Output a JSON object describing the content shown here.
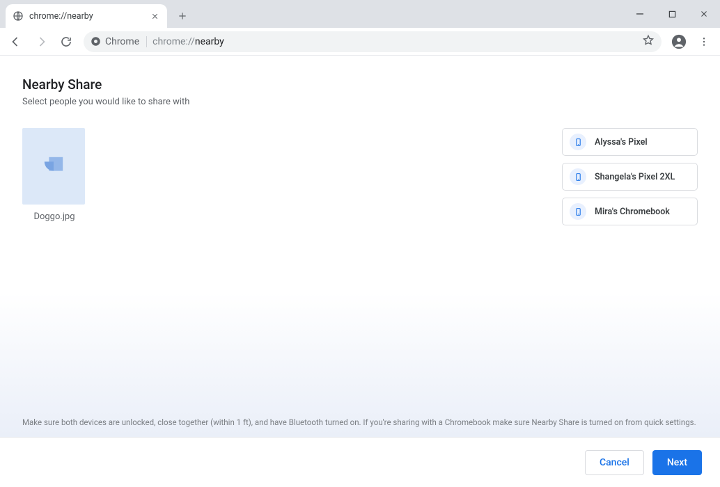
{
  "window": {
    "tab_title": "chrome://nearby"
  },
  "omnibox": {
    "chip_label": "Chrome",
    "url_prefix": "chrome://",
    "url_path": "nearby"
  },
  "page": {
    "title": "Nearby Share",
    "subtitle": "Select people you would like to share with",
    "file": {
      "name": "Doggo.jpg"
    },
    "devices": [
      {
        "name": "Alyssa's Pixel",
        "icon": "phone-icon"
      },
      {
        "name": "Shangela's Pixel 2XL",
        "icon": "phone-icon"
      },
      {
        "name": "Mira's Chromebook",
        "icon": "phone-icon"
      }
    ],
    "helper_text": "Make sure both devices are unlocked, close together (within 1 ft), and have Bluetooth turned on. If you're sharing with a Chromebook make sure Nearby Share is turned on from quick settings."
  },
  "footer": {
    "cancel": "Cancel",
    "next": "Next"
  }
}
